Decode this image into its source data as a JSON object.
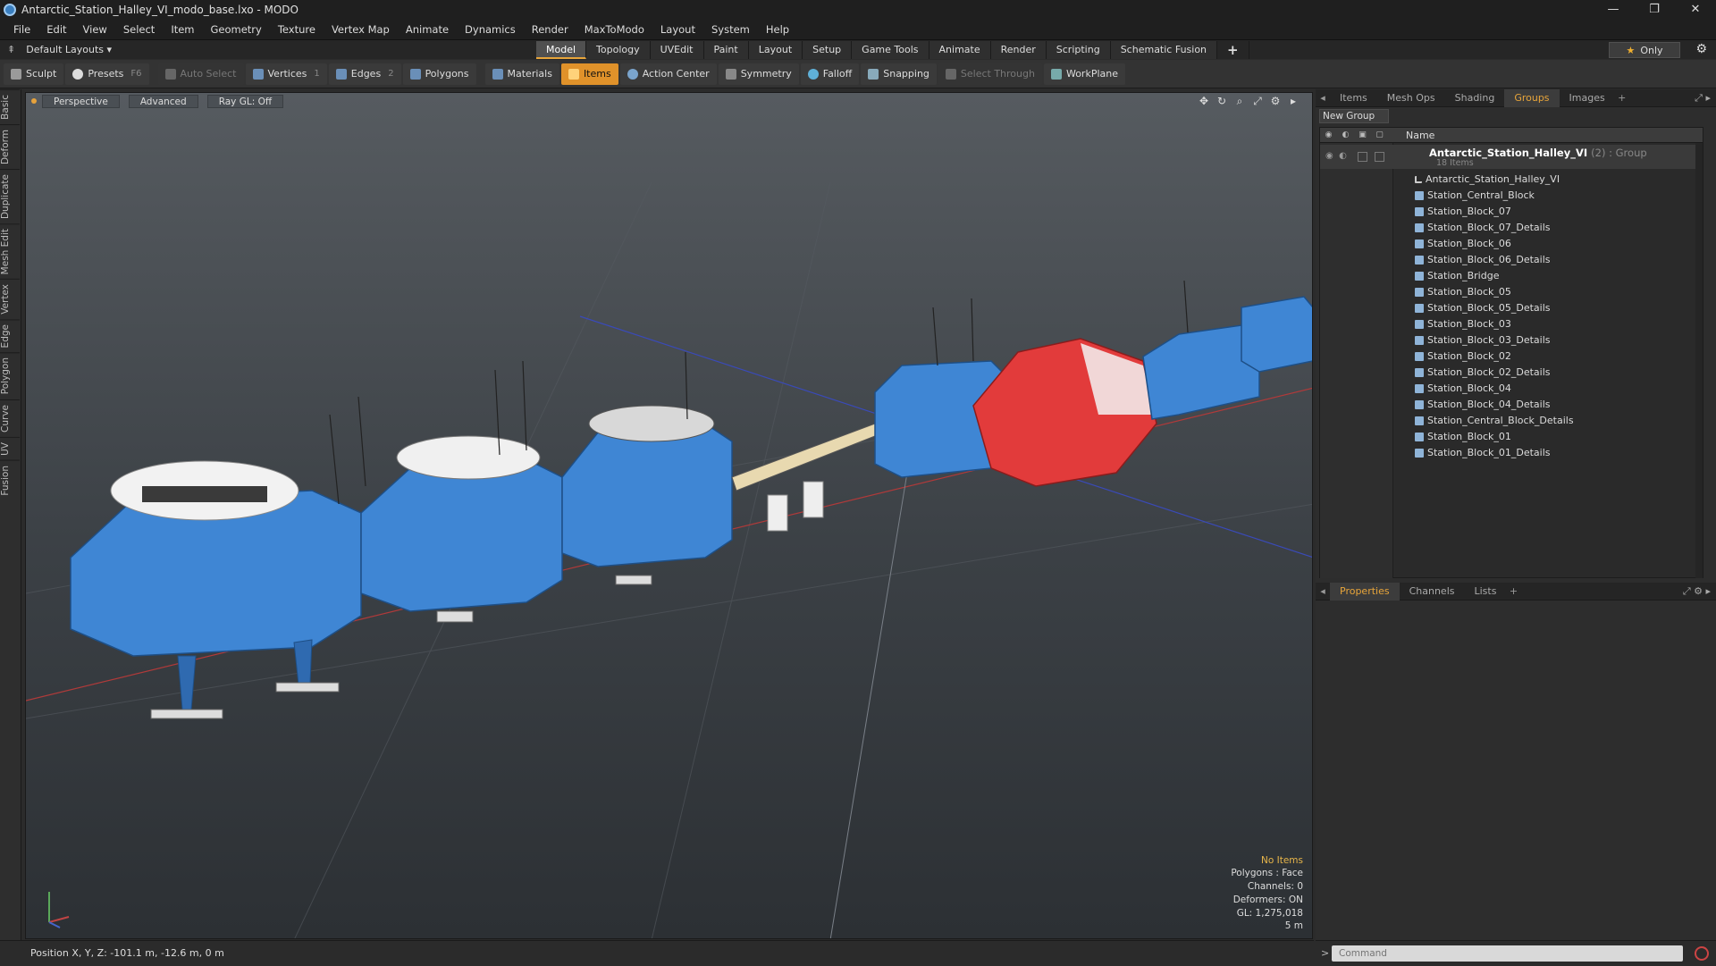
{
  "window": {
    "title": "Antarctic_Station_Halley_VI_modo_base.lxo - MODO",
    "controls": [
      "—",
      "❐",
      "✕"
    ]
  },
  "menu": [
    "File",
    "Edit",
    "View",
    "Select",
    "Item",
    "Geometry",
    "Texture",
    "Vertex Map",
    "Animate",
    "Dynamics",
    "Render",
    "MaxToModo",
    "Layout",
    "System",
    "Help"
  ],
  "layout_bar": {
    "layouts_label": "Default Layouts ▾",
    "modes": [
      "Model",
      "Topology",
      "UVEdit",
      "Paint",
      "Layout",
      "Setup",
      "Game Tools",
      "Animate",
      "Render",
      "Scripting",
      "Schematic Fusion"
    ],
    "active_mode": "Model",
    "plus": "+",
    "only_label": "Only"
  },
  "toolbar": {
    "sculpt": "Sculpt",
    "presets": "Presets",
    "presets_key": "F6",
    "auto_select": "Auto Select",
    "vertices": "Vertices",
    "vertices_key": "1",
    "edges": "Edges",
    "edges_key": "2",
    "polygons": "Polygons",
    "materials": "Materials",
    "items": "Items",
    "action_center": "Action Center",
    "symmetry": "Symmetry",
    "falloff": "Falloff",
    "snapping": "Snapping",
    "select_through": "Select Through",
    "workplane": "WorkPlane"
  },
  "left_tabs": [
    "Basic",
    "Deform",
    "Duplicate",
    "Mesh Edit",
    "Vertex",
    "Edge",
    "Polygon",
    "Curve",
    "UV",
    "Fusion"
  ],
  "viewport": {
    "view": "Perspective",
    "shading": "Advanced",
    "raygl": "Ray GL: Off",
    "info": {
      "items": "No Items",
      "polygons": "Polygons : Face",
      "channels": "Channels: 0",
      "deformers": "Deformers: ON",
      "gl": "GL: 1,275,018",
      "scale": "5 m"
    }
  },
  "status": {
    "position": "Position X, Y, Z:  -101.1 m, -12.6 m, 0 m"
  },
  "right_panel": {
    "tabs": [
      "Items",
      "Mesh Ops",
      "Shading",
      "Groups",
      "Images"
    ],
    "active_tab": "Groups",
    "new_group": "New Group",
    "column_name": "Name",
    "group": {
      "name": "Antarctic_Station_Halley_VI",
      "meta": "(2) : Group",
      "count": "18 Items"
    },
    "items": [
      "Antarctic_Station_Halley_VI",
      "Station_Central_Block",
      "Station_Block_07",
      "Station_Block_07_Details",
      "Station_Block_06",
      "Station_Block_06_Details",
      "Station_Bridge",
      "Station_Block_05",
      "Station_Block_05_Details",
      "Station_Block_03",
      "Station_Block_03_Details",
      "Station_Block_02",
      "Station_Block_02_Details",
      "Station_Block_04",
      "Station_Block_04_Details",
      "Station_Central_Block_Details",
      "Station_Block_01",
      "Station_Block_01_Details"
    ],
    "props_tabs": [
      "Properties",
      "Channels",
      "Lists"
    ],
    "active_props_tab": "Properties",
    "command_placeholder": "Command"
  },
  "colors": {
    "accent": "#e8a53a",
    "module_blue": "#3f86d4",
    "module_red": "#e23b3b"
  }
}
